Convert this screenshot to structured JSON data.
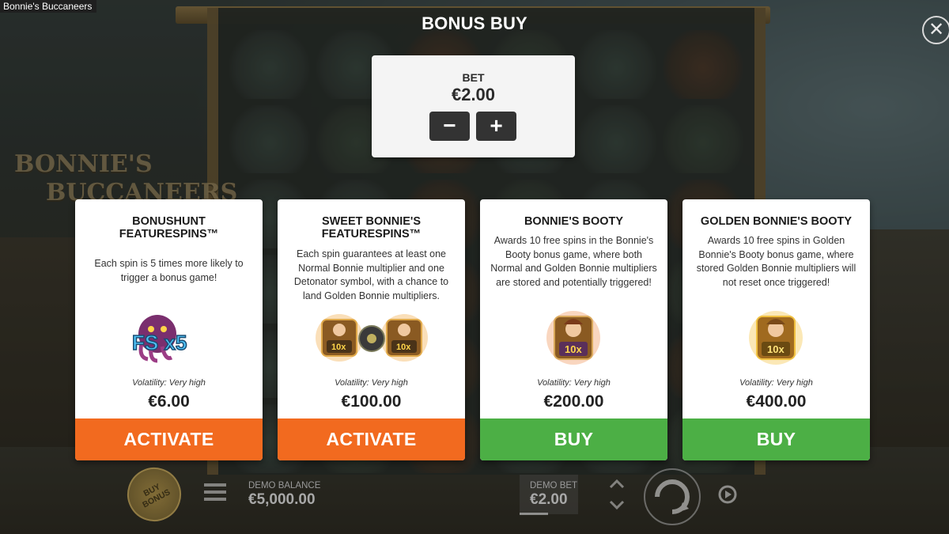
{
  "window": {
    "title": "Bonnie's Buccaneers"
  },
  "background": {
    "logo_line1": "BONNIE'S",
    "logo_line2": "BUCCANEERS"
  },
  "dialog": {
    "title": "BONUS BUY",
    "close_symbol": "✕",
    "bet": {
      "label": "BET",
      "value": "€2.00",
      "minus_label": "−",
      "plus_label": "+"
    },
    "cards": [
      {
        "title": "BONUSHUNT FEATURESPINS™",
        "description": "Each spin is 5 times more likely to trigger a bonus game!",
        "icon": "fs-x5-octopus-icon",
        "icon_text": "FS x5",
        "volatility": "Volatility: Very high",
        "price": "€6.00",
        "button_label": "ACTIVATE",
        "button_color": "#f26a1f"
      },
      {
        "title": "SWEET BONNIE'S FEATURESPINS™",
        "description": "Each spin guarantees at least one Normal Bonnie multiplier and one Detonator symbol, with a chance to land Golden Bonnie multipliers.",
        "icon": "bonnie-multipliers-with-detonator-icon",
        "icon_text": "10x",
        "volatility": "Volatility: Very high",
        "price": "€100.00",
        "button_label": "ACTIVATE",
        "button_color": "#f26a1f"
      },
      {
        "title": "BONNIE'S BOOTY",
        "description": "Awards 10 free spins in the Bonnie's Booty bonus game, where both Normal and Golden Bonnie multipliers are stored and potentially triggered!",
        "icon": "bonnie-10x-multiplier-icon",
        "icon_text": "10x",
        "volatility": "Volatility: Very high",
        "price": "€200.00",
        "button_label": "BUY",
        "button_color": "#4caf45"
      },
      {
        "title": "GOLDEN BONNIE'S BOOTY",
        "description": "Awards 10 free spins in Golden Bonnie's Booty bonus game, where stored Golden Bonnie multipliers will not reset once triggered!",
        "icon": "golden-bonnie-10x-multiplier-icon",
        "icon_text": "10x",
        "volatility": "Volatility: Very high",
        "price": "€400.00",
        "button_label": "BUY",
        "button_color": "#4caf45"
      }
    ]
  },
  "bottom_bar": {
    "buy_bonus_label": "BUY BONUS",
    "demo_balance_label": "DEMO BALANCE",
    "demo_balance_value": "€5,000.00",
    "demo_bet_label": "DEMO BET",
    "demo_bet_value": "€2.00"
  }
}
